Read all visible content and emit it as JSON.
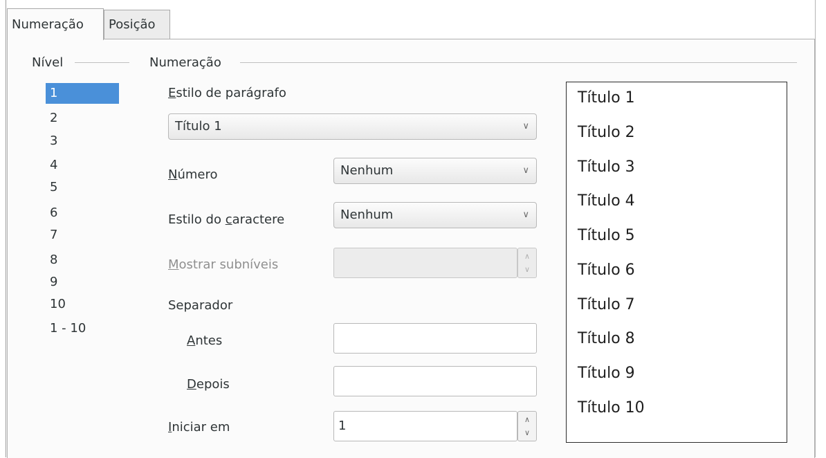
{
  "tabs": [
    {
      "label": "Numeração",
      "active": true
    },
    {
      "label": "Posição",
      "active": false
    }
  ],
  "level": {
    "frame_label": "Nível",
    "items": [
      "1",
      "2",
      "3",
      "4",
      "5",
      "6",
      "7",
      "8",
      "9",
      "10",
      "1 - 10"
    ],
    "selected": "1"
  },
  "numbering": {
    "frame_label": "Numeração",
    "paragraph_style": {
      "label_mnemonic": "E",
      "label_rest": "stilo de parágrafo",
      "value": "Título 1"
    },
    "number": {
      "label_mnemonic": "N",
      "label_rest": "úmero",
      "value": "Nenhum"
    },
    "char_style": {
      "label_pre": "Estilo do ",
      "label_mnemonic": "c",
      "label_rest": "aractere",
      "value": "Nenhum"
    },
    "sublevels": {
      "label_mnemonic": "M",
      "label_rest": "ostrar subníveis",
      "value": "",
      "enabled": false
    },
    "separator": {
      "label": "Separador",
      "before": {
        "label_mnemonic": "A",
        "label_rest": "ntes",
        "value": ""
      },
      "after": {
        "label_mnemonic": "D",
        "label_rest": "epois",
        "value": ""
      }
    },
    "start_at": {
      "label_mnemonic": "I",
      "label_rest": "niciar em",
      "value": "1"
    }
  },
  "preview": {
    "items": [
      "Título 1",
      "Título 2",
      "Título 3",
      "Título 4",
      "Título 5",
      "Título 6",
      "Título 7",
      "Título 8",
      "Título 9",
      "Título 10"
    ]
  },
  "icons": {
    "dropdown": "chevron-down-icon",
    "spin_up": "chevron-up-icon",
    "spin_down": "chevron-down-icon"
  },
  "colors": {
    "selection": "#4a90d9",
    "disabled_text": "#8f8f8f",
    "preview_border": "#2b2b2b"
  }
}
